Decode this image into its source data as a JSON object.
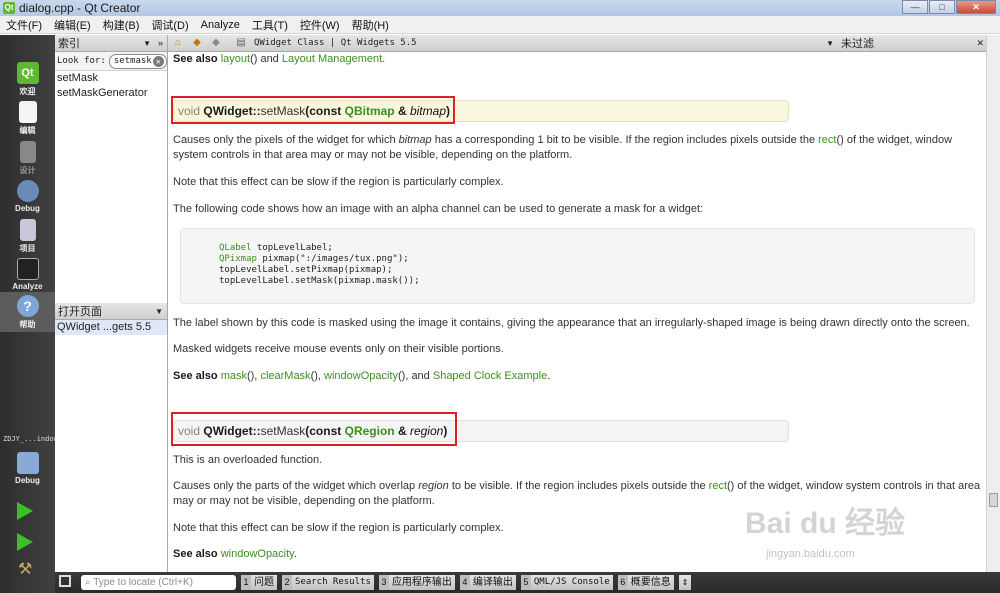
{
  "window": {
    "title": "dialog.cpp - Qt Creator",
    "app_icon": "Qt"
  },
  "menu": [
    "文件(F)",
    "编辑(E)",
    "构建(B)",
    "调试(D)",
    "Analyze",
    "工具(T)",
    "控件(W)",
    "帮助(H)"
  ],
  "modes": [
    {
      "label": "欢迎",
      "icon": "qt-logo-icon"
    },
    {
      "label": "编辑",
      "icon": "edit-document-icon"
    },
    {
      "label": "设计",
      "icon": "design-icon"
    },
    {
      "label": "Debug",
      "icon": "debug-icon"
    },
    {
      "label": "项目",
      "icon": "project-icon"
    },
    {
      "label": "Analyze",
      "icon": "analyze-icon"
    },
    {
      "label": "帮助",
      "icon": "help-icon"
    }
  ],
  "kit": {
    "name": "ZDJY_...indow",
    "mode": "Debug"
  },
  "index_pane": {
    "title": "索引",
    "look_for_label": "Look for:",
    "search_value": "setmask",
    "results": [
      "setMask",
      "setMaskGenerator"
    ]
  },
  "open_pages": {
    "title": "打开页面",
    "items": [
      "QWidget ...gets 5.5"
    ]
  },
  "doc_toolbar": {
    "document": "QWidget Class | Qt Widgets 5.5"
  },
  "filter_pane": {
    "title": "未过滤"
  },
  "doc": {
    "see_also_top": {
      "prefix": "See also",
      "link1": "layout",
      "mid": "() and",
      "link2": "Layout Management",
      "end": "."
    },
    "sig1": {
      "kw": "void",
      "cls": "QWidget::",
      "fn": "setMask",
      "open": "(const",
      "type": "QBitmap",
      "amp": " & ",
      "param": "bitmap",
      "close": ")"
    },
    "p1": {
      "a": "Causes only the pixels of the widget for which",
      "b": "bitmap",
      "c": "has a corresponding 1 bit to be visible. If the region includes pixels outside the",
      "link": "rect",
      "d": "() of the widget, window system controls in that area may or may not be visible, depending on the platform."
    },
    "p2": "Note that this effect can be slow if the region is particularly complex.",
    "p3": "The following code shows how an image with an alpha channel can be used to generate a mask for a widget:",
    "code": [
      {
        "type": "QLabel",
        "rest": " topLevelLabel;"
      },
      {
        "type": "QPixmap",
        "rest": " pixmap(\":/images/tux.png\");"
      },
      {
        "type": "",
        "rest": "topLevelLabel.setPixmap(pixmap);"
      },
      {
        "type": "",
        "rest": "topLevelLabel.setMask(pixmap.mask());"
      }
    ],
    "p4": "The label shown by this code is masked using the image it contains, giving the appearance that an irregularly-shaped image is being drawn directly onto the screen.",
    "p5": "Masked widgets receive mouse events only on their visible portions.",
    "see_also_mid": {
      "prefix": "See also",
      "l1": "mask",
      "s1": "(),",
      "l2": "clearMask",
      "s2": "(),",
      "l3": "windowOpacity",
      "s3": "(), and",
      "l4": "Shaped Clock Example",
      "s4": "."
    },
    "sig2": {
      "kw": "void",
      "cls": "QWidget::",
      "fn": "setMask",
      "open": "(const",
      "type": "QRegion",
      "amp": " & ",
      "param": "region",
      "close": ")"
    },
    "p6": "This is an overloaded function.",
    "p7": {
      "a": "Causes only the parts of the widget which overlap",
      "b": "region",
      "c": "to be visible. If the region includes pixels outside the",
      "link": "rect",
      "d": "() of the widget, window system controls in that area may or may not be visible, depending on the platform."
    },
    "p8": "Note that this effect can be slow if the region is particularly complex.",
    "see_also_bottom": {
      "prefix": "See also",
      "link": "windowOpacity",
      "end": "."
    }
  },
  "statusbar": {
    "locate_placeholder": "Type to locate (Ctrl+K)",
    "tabs": [
      {
        "num": "1",
        "label": "问题"
      },
      {
        "num": "2",
        "label": "Search Results"
      },
      {
        "num": "3",
        "label": "应用程序输出"
      },
      {
        "num": "4",
        "label": "编译输出"
      },
      {
        "num": "5",
        "label": "QML/JS Console"
      },
      {
        "num": "6",
        "label": "概要信息"
      }
    ]
  },
  "watermark": {
    "main": "Bai du 经验",
    "sub": "jingyan.baidu.com"
  }
}
